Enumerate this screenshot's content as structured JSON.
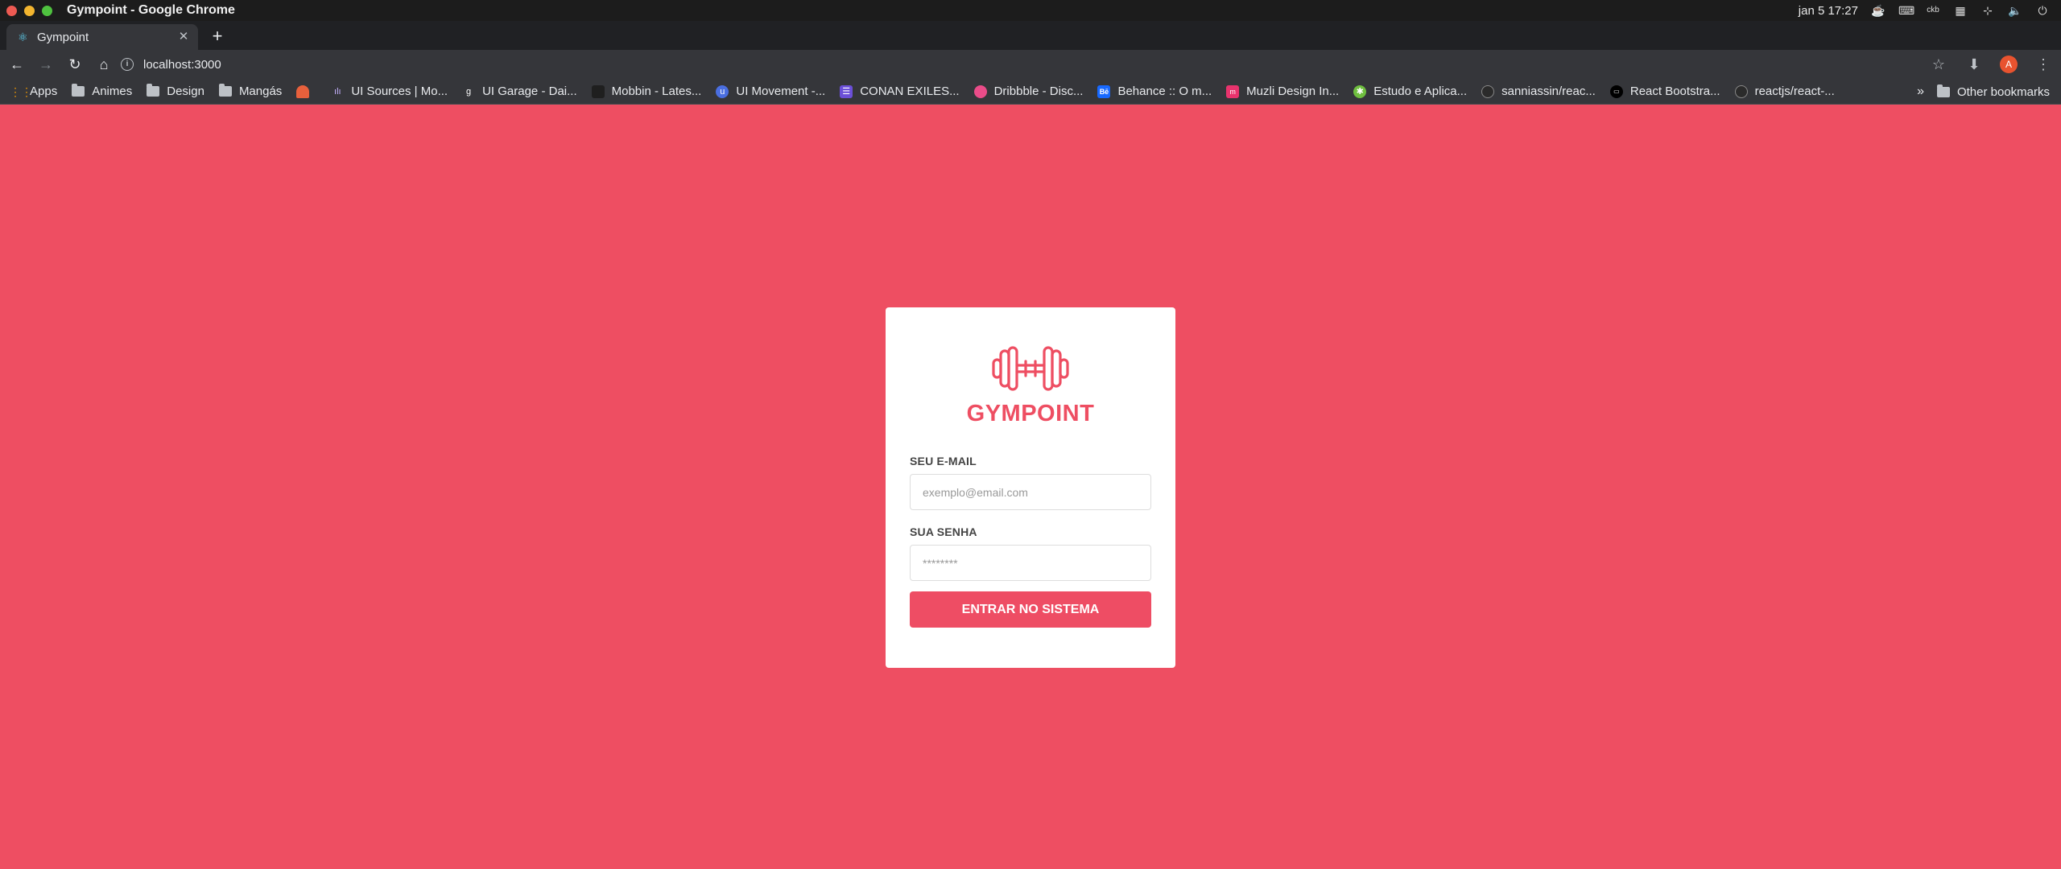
{
  "os": {
    "window_title": "Gympoint - Google Chrome",
    "clock": "jan 5  17:27",
    "tray_icons": [
      "coffee-icon",
      "keyboard-icon",
      "keyboard-layout-icon",
      "grid-icon",
      "network-icon",
      "volume-icon",
      "power-icon"
    ]
  },
  "browser": {
    "tab": {
      "title": "Gympoint",
      "favicon": "react-icon"
    },
    "url": "localhost:3000",
    "avatar_letter": "A",
    "bookmarks": [
      {
        "label": "Apps",
        "icon": "apps-grid-icon"
      },
      {
        "label": "Animes",
        "icon": "folder-icon"
      },
      {
        "label": "Design",
        "icon": "folder-icon"
      },
      {
        "label": "Mangás",
        "icon": "folder-icon"
      },
      {
        "label": "",
        "icon": "site-favicon"
      },
      {
        "label": "UI Sources | Mo...",
        "icon": "site-favicon"
      },
      {
        "label": "UI Garage - Dai...",
        "icon": "site-favicon"
      },
      {
        "label": "Mobbin - Lates...",
        "icon": "site-favicon"
      },
      {
        "label": "UI Movement -...",
        "icon": "site-favicon"
      },
      {
        "label": "CONAN EXILES...",
        "icon": "site-favicon"
      },
      {
        "label": "Dribbble - Disc...",
        "icon": "dribbble-icon"
      },
      {
        "label": "Behance :: O m...",
        "icon": "behance-icon"
      },
      {
        "label": "Muzli Design In...",
        "icon": "site-favicon"
      },
      {
        "label": "Estudo e Aplica...",
        "icon": "site-favicon"
      },
      {
        "label": "sanniassin/reac...",
        "icon": "github-icon"
      },
      {
        "label": "React Bootstra...",
        "icon": "site-favicon"
      },
      {
        "label": "reactjs/react-...",
        "icon": "github-icon"
      }
    ],
    "more_bookmarks": "»",
    "other_bookmarks": "Other bookmarks"
  },
  "login": {
    "brand": "GYMPOINT",
    "email_label": "SEU E-MAIL",
    "email_placeholder": "exemplo@email.com",
    "password_label": "SUA SENHA",
    "password_placeholder": "********",
    "submit_label": "ENTRAR NO SISTEMA"
  },
  "colors": {
    "background": "#ee4e62",
    "accent": "#ee4d64",
    "card": "#ffffff"
  }
}
